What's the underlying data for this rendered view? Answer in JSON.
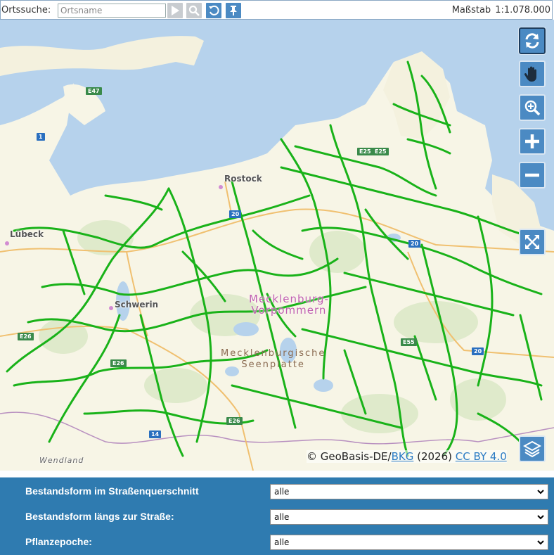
{
  "search": {
    "label": "Ortssuche:",
    "placeholder": "Ortsname",
    "buttons": [
      "play-icon",
      "search-icon",
      "undo-icon",
      "pin-icon"
    ]
  },
  "scale": {
    "label": "Maßstab",
    "value": "1:1.078.000"
  },
  "map": {
    "places": {
      "rostock": "Rostock",
      "luebeck": "Lübeck",
      "schwerin": "Schwerin",
      "wendland": "Wendland",
      "region1_line1": "Mecklenburg-",
      "region1_line2": "Vorpommern",
      "region2_line1": "Mecklenburgische",
      "region2_line2": "Seenplatte"
    },
    "shields": [
      "E47",
      "1",
      "E25",
      "E25",
      "20",
      "20",
      "20",
      "E26",
      "E26",
      "E55",
      "E26",
      "14"
    ],
    "controls": [
      "refresh-icon",
      "pan-hand-icon",
      "zoom-box-icon",
      "zoom-in-icon",
      "zoom-out-icon",
      "fullscreen-icon",
      "layers-icon"
    ],
    "attribution": {
      "prefix": "© GeoBasis-DE/",
      "link1": "BKG",
      "middle": " (2026) ",
      "link2": "CC BY 4.0"
    },
    "colors": {
      "sea": "#b6d2ec",
      "land": "#f7f5e6",
      "network": "#19b219"
    }
  },
  "filters": [
    {
      "label": "Bestandsform im Straßenquerschnitt",
      "value": "alle"
    },
    {
      "label": "Bestandsform längs zur Straße:",
      "value": "alle"
    },
    {
      "label": "Pflanzepoche:",
      "value": "alle"
    }
  ]
}
